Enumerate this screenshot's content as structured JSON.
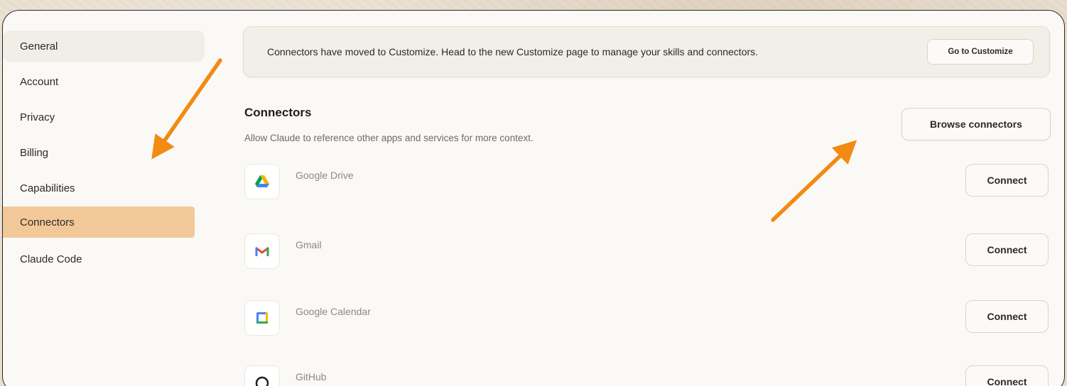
{
  "sidebar": {
    "items": [
      {
        "label": "General"
      },
      {
        "label": "Account"
      },
      {
        "label": "Privacy"
      },
      {
        "label": "Billing"
      },
      {
        "label": "Capabilities"
      },
      {
        "label": "Connectors"
      },
      {
        "label": "Claude Code"
      }
    ],
    "active": "Connectors",
    "active_color": "#f3c899"
  },
  "banner": {
    "text": "Connectors have moved to Customize. Head to the new Customize page to manage your skills and connectors.",
    "button_label": "Go to Customize"
  },
  "connectors_section": {
    "title": "Connectors",
    "description": "Allow Claude to reference other apps and services for more context.",
    "browse_label": "Browse connectors",
    "items": [
      {
        "name": "Google Drive",
        "icon": "google-drive-icon",
        "button": "Connect"
      },
      {
        "name": "Gmail",
        "icon": "gmail-icon",
        "button": "Connect"
      },
      {
        "name": "Google Calendar",
        "icon": "google-calendar-icon",
        "button": "Connect"
      },
      {
        "name": "GitHub",
        "icon": "github-icon",
        "button": "Connect"
      }
    ]
  },
  "annotation_color": "#f28a13"
}
